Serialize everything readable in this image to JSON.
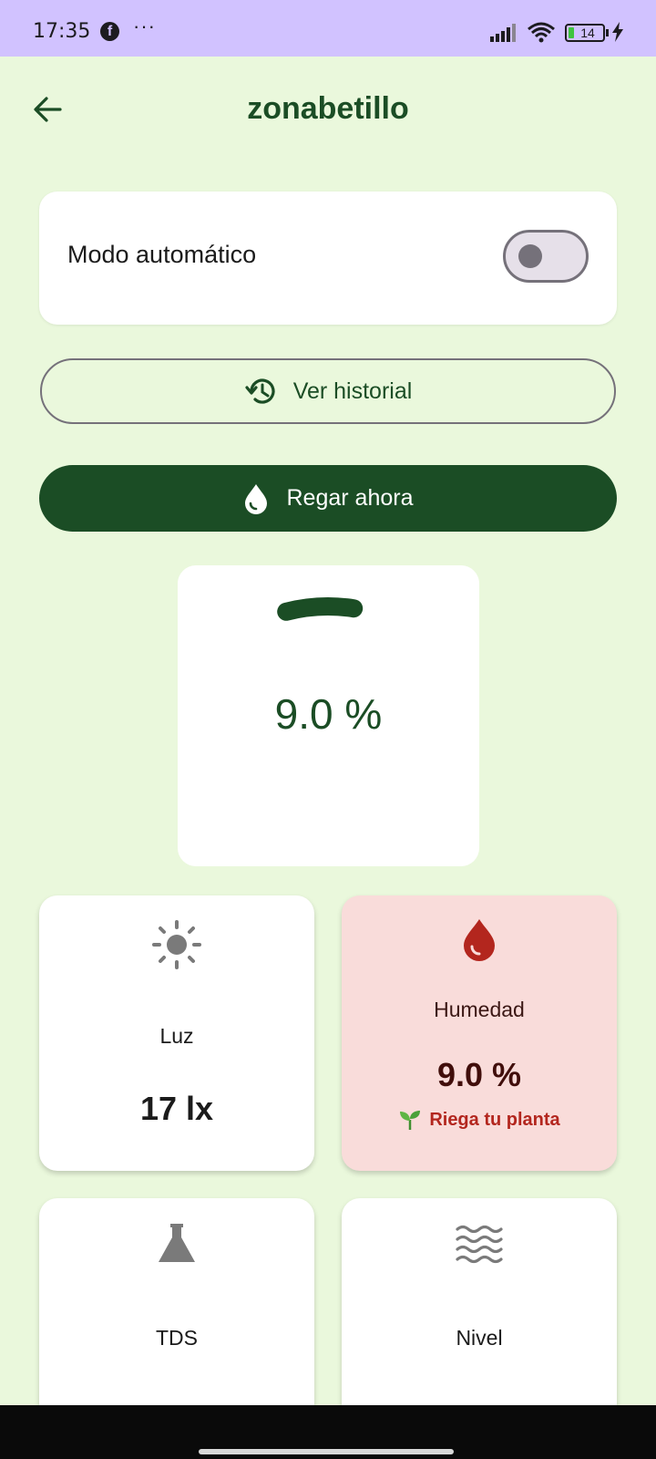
{
  "status_bar": {
    "time": "17:35",
    "battery_level": "14",
    "icons": [
      "facebook-icon",
      "more-icon",
      "signal-icon",
      "wifi-icon",
      "battery-icon",
      "charging-icon"
    ]
  },
  "header": {
    "title": "zonabetillo",
    "back_icon": "arrow-back-icon"
  },
  "auto_mode": {
    "label": "Modo automático",
    "enabled": false
  },
  "actions": {
    "history_label": "Ver historial",
    "water_label": "Regar ahora"
  },
  "gauge": {
    "value_text": "9.0 %",
    "value": 9.0
  },
  "sensors": [
    {
      "title": "Luz",
      "value": "17 lx",
      "icon": "sun-icon"
    },
    {
      "title": "Humedad",
      "value": "9.0 %",
      "icon": "water-drop-icon",
      "hint": "Riega tu planta",
      "hint_icon": "seedling-icon"
    },
    {
      "title": "TDS",
      "icon": "flask-icon"
    },
    {
      "title": "Nivel",
      "icon": "waves-icon"
    }
  ],
  "colors": {
    "primary": "#1b4d25",
    "background": "#eaf8dc",
    "status_bar": "#d1c2ff",
    "alert_bg": "#f9dcda",
    "alert_text": "#b3261e"
  }
}
